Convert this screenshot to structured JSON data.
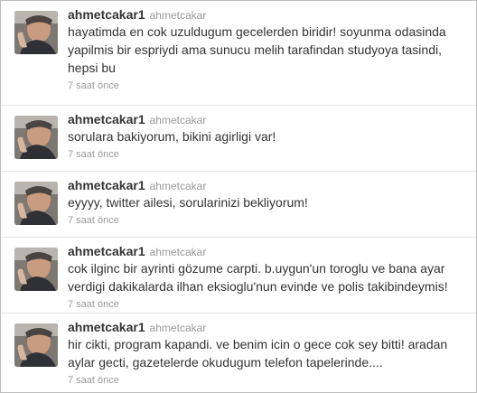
{
  "tweets": [
    {
      "screen_name": "ahmetcakar1",
      "full_name": "ahmetcakar",
      "lines": [
        "hayatimda en cok uzuldugum gecelerden biridir! soyunma odasinda",
        "yapilmis bir espriydi ama sunucu melih tarafindan studyoya tasindi,",
        "hepsi bu"
      ],
      "time": "7 saat önce",
      "avatar_icon": "user-avatar-icon"
    },
    {
      "screen_name": "ahmetcakar1",
      "full_name": "ahmetcakar",
      "lines": [
        "sorulara bakiyorum, bikini agirligi var!"
      ],
      "time": "7 saat önce",
      "avatar_icon": "user-avatar-icon"
    },
    {
      "screen_name": "ahmetcakar1",
      "full_name": "ahmetcakar",
      "lines": [
        "eyyyy, twitter ailesi, sorularinizi bekliyorum!"
      ],
      "time": "7 saat önce",
      "avatar_icon": "user-avatar-icon"
    },
    {
      "screen_name": "ahmetcakar1",
      "full_name": "ahmetcakar",
      "lines": [
        "cok ilginc bir ayrinti gözume carpti. b.uygun'un toroglu ve bana ayar",
        "verdigi dakikalarda ilhan eksioglu'nun evinde ve polis takibindeymis!"
      ],
      "time": "7 saat önce",
      "avatar_icon": "user-avatar-icon"
    },
    {
      "screen_name": "ahmetcakar1",
      "full_name": "ahmetcakar",
      "lines": [
        "hir cikti, program kapandi. ve benim icin o gece cok sey bitti! aradan",
        "aylar gecti, gazetelerde okudugum telefon tapelerinde...."
      ],
      "time": "7 saat önce",
      "avatar_icon": "user-avatar-icon"
    }
  ],
  "colors": {
    "text": "#333333",
    "muted": "#999999",
    "divider": "#e3e3e3",
    "frame": "#bdbdbd"
  }
}
